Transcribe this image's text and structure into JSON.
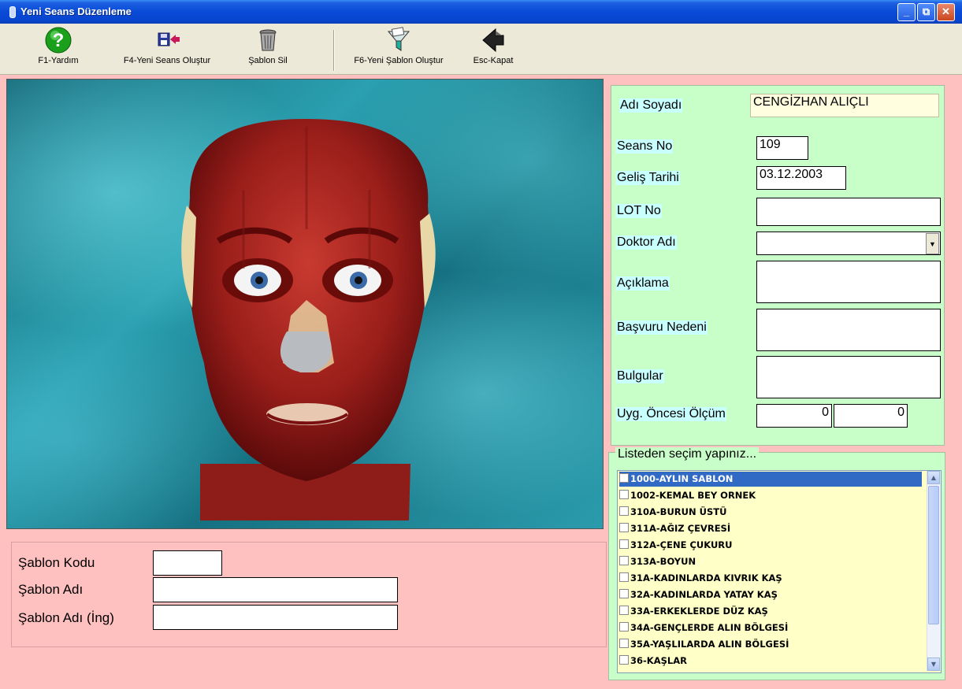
{
  "window": {
    "title": "Yeni Seans Düzenleme",
    "buttons": [
      "_",
      "⧉",
      "✕"
    ]
  },
  "toolbar": {
    "help": "F1-Yardım",
    "new_session": "F4-Yeni Seans Oluştur",
    "delete_template": "Şablon Sil",
    "new_template": "F6-Yeni Şablon Oluştur",
    "close": "Esc-Kapat"
  },
  "form": {
    "name_label": "Adı Soyadı",
    "name_value": "CENGİZHAN ALIÇLI",
    "session_label": "Seans No",
    "session_value": "109",
    "date_label": "Geliş Tarihi",
    "date_value": "03.12.2003",
    "lot_label": "LOT No",
    "lot_value": "",
    "doctor_label": "Doktor Adı",
    "doctor_value": "",
    "desc_label": "Açıklama",
    "reason_label": "Başvuru Nedeni",
    "findings_label": "Bulgular",
    "measure_label": "Uyg. Öncesi Ölçüm",
    "measure_value1": "0",
    "measure_value2": "0"
  },
  "list": {
    "legend": "Listeden seçim yapınız...",
    "items": [
      "1000-AYLIN SABLON",
      "1002-KEMAL BEY ORNEK",
      "310A-BURUN ÜSTÜ",
      "311A-AĞIZ ÇEVRESİ",
      "312A-ÇENE ÇUKURU",
      "313A-BOYUN",
      "31A-KADINLARDA KIVRIK KAŞ",
      "32A-KADINLARDA YATAY KAŞ",
      "33A-ERKEKLERDE DÜZ KAŞ",
      "34A-GENÇLERDE ALIN BÖLGESİ",
      "35A-YAŞLILARDA ALIN BÖLGESİ",
      "36-KAŞLAR"
    ],
    "selected_index": 0
  },
  "template": {
    "code_label": "Şablon Kodu",
    "name_label": "Şablon Adı",
    "name_en_label": "Şablon Adı (İng)"
  }
}
